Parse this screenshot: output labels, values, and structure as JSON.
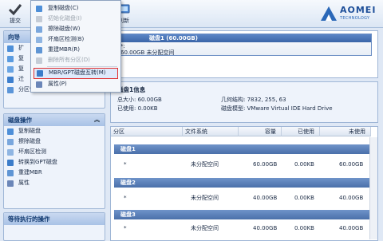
{
  "toolbar": {
    "submit_label": "提交",
    "refresh_label": "刷新",
    "logo_word": "AOMEI",
    "logo_sub": "TECHNOLOGY"
  },
  "context_menu": {
    "items": [
      {
        "label": "复制磁盘(C)",
        "disabled": false
      },
      {
        "label": "初始化磁盘(I)",
        "disabled": true
      },
      {
        "label": "擦除磁盘(W)",
        "disabled": false
      },
      {
        "label": "坏扇区检测(B)",
        "disabled": false
      },
      {
        "label": "重建MBR(R)",
        "disabled": false
      },
      {
        "label": "删除所有分区(D)",
        "disabled": true
      },
      {
        "label": "MBR/GPT磁盘互转(M)",
        "disabled": false,
        "highlighted": true
      },
      {
        "label": "属性(P)",
        "disabled": false
      }
    ]
  },
  "wizard_panel": {
    "title": "向导",
    "items": [
      "扩",
      "复",
      "复",
      "迁",
      "分区恢复向导"
    ]
  },
  "disk_ops_panel": {
    "title": "磁盘操作",
    "items": [
      "复制磁盘",
      "擦除磁盘",
      "坏扇区检测",
      "转换到GPT磁盘",
      "重建MBR",
      "属性"
    ]
  },
  "pending_panel": {
    "title": "等待执行的操作"
  },
  "disk_view": {
    "title": "磁盘1 (60.00GB)",
    "line1": "*:",
    "line2": "60.00GB 未分配空间"
  },
  "disk_info": {
    "title": "磁盘1信息",
    "total_label": "总大小: 60.00GB",
    "used_label": "已使用: 0.00KB",
    "geometry_label": "几何结构: 7832, 255, 63",
    "model_label": "磁盘模型: VMware Virtual IDE Hard Drive"
  },
  "table": {
    "columns": [
      "分区",
      "文件系统",
      "容量",
      "已使用",
      "未使用"
    ],
    "groups": [
      {
        "name": "磁盘1",
        "rows": [
          [
            "*",
            "未分配空间",
            "60.00GB",
            "0.00KB",
            "60.00GB"
          ]
        ]
      },
      {
        "name": "磁盘2",
        "rows": [
          [
            "*",
            "未分配空间",
            "40.00GB",
            "0.00KB",
            "40.00GB"
          ]
        ]
      },
      {
        "name": "磁盘3",
        "rows": [
          [
            "*",
            "未分配空间",
            "40.00GB",
            "0.00KB",
            "40.00GB"
          ]
        ]
      }
    ]
  },
  "colors": {
    "accent": "#3c66a8",
    "highlight_border": "#e03030"
  }
}
